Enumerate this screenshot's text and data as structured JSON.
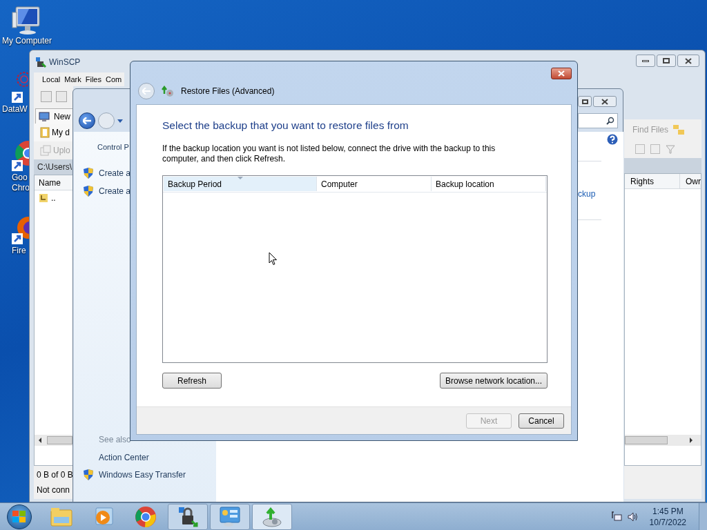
{
  "desktop": {
    "icons": [
      {
        "kind": "computer",
        "lines": [
          "My Computer"
        ]
      },
      {
        "kind": "network",
        "lines": [
          "DataW"
        ]
      },
      {
        "kind": "chrome",
        "lines": [
          "Goo",
          "Chro"
        ]
      },
      {
        "kind": "firefox",
        "lines": [
          "Fire"
        ]
      }
    ]
  },
  "winscp": {
    "title": "WinSCP",
    "menu": [
      "Local",
      "Mark",
      "Files",
      "Com"
    ],
    "session_tab": "New",
    "folder_button": "My d",
    "upload_button": {
      "label": "Uplo",
      "disabled": true
    },
    "path": "C:\\Users\\",
    "left_columns": [
      "Name"
    ],
    "files": [
      ".."
    ],
    "find_files": "Find Files",
    "right_columns": [
      "Rights",
      "Owr"
    ],
    "status": [
      "0 B of 0 B",
      "Not conn"
    ]
  },
  "control_panel": {
    "breadcrumb": "Control P",
    "tasks": [
      "Create a",
      "Create a"
    ],
    "see_also": {
      "heading": "See also",
      "links": [
        {
          "label": "Action Center",
          "shield": false
        },
        {
          "label": "Windows Easy Transfer",
          "shield": true
        }
      ]
    },
    "side_link": "ckup"
  },
  "dialog": {
    "title": "Restore Files (Advanced)",
    "heading": "Select the backup that you want to restore files from",
    "instruction": "If the backup location you want is not listed below, connect the drive with the backup to this computer, and then click Refresh.",
    "columns": [
      {
        "label": "Backup Period",
        "selected": true
      },
      {
        "label": "Computer",
        "selected": false
      },
      {
        "label": "Backup location",
        "selected": false
      }
    ],
    "refresh": "Refresh",
    "browse": "Browse network location...",
    "footer_buttons": [
      {
        "label": "Next",
        "disabled": true
      },
      {
        "label": "Cancel",
        "disabled": false
      }
    ]
  },
  "taskbar": {
    "items": [
      {
        "kind": "explorer",
        "open": false,
        "active": false
      },
      {
        "kind": "media",
        "open": false,
        "active": false
      },
      {
        "kind": "chrome",
        "open": false,
        "active": false
      },
      {
        "kind": "lock",
        "open": true,
        "active": false
      },
      {
        "kind": "panel",
        "open": true,
        "active": false
      },
      {
        "kind": "backup",
        "open": true,
        "active": true
      }
    ],
    "clock": {
      "time": "1:45 PM",
      "date": "10/7/2022"
    }
  }
}
